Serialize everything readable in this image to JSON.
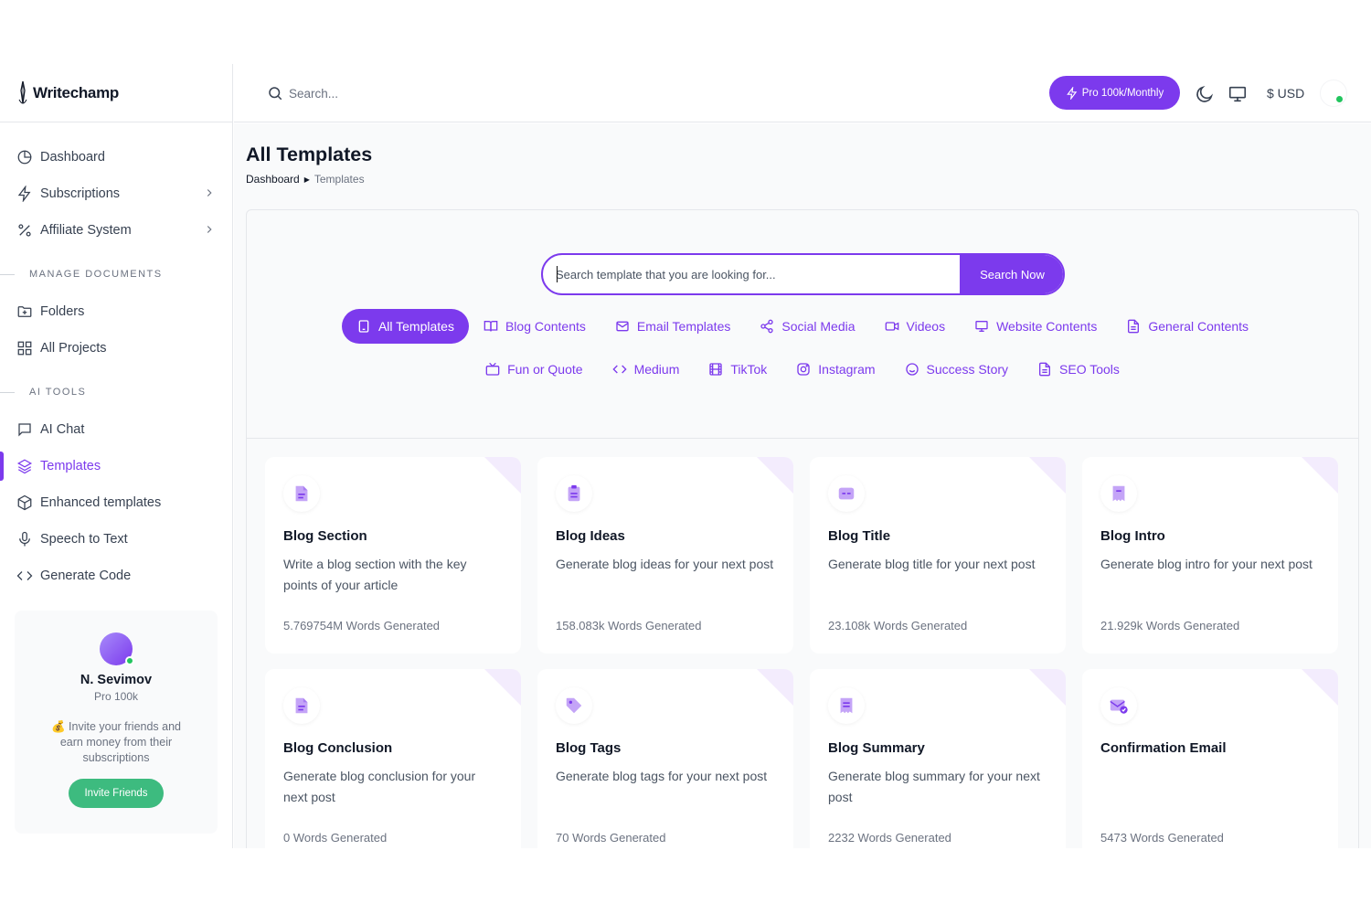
{
  "brand": {
    "name": "Writechamp"
  },
  "topbar": {
    "search_placeholder": "Search...",
    "plan_button": "Pro 100k/Monthly",
    "currency": "$ USD"
  },
  "sidebar": {
    "items": [
      {
        "label": "Dashboard",
        "icon": "pie-chart-icon"
      },
      {
        "label": "Subscriptions",
        "icon": "lightning-icon"
      },
      {
        "label": "Affiliate System",
        "icon": "percent-icon"
      }
    ],
    "section_documents": "MANAGE DOCUMENTS",
    "doc_items": [
      {
        "label": "Folders",
        "icon": "folder-plus-icon"
      },
      {
        "label": "All Projects",
        "icon": "grid-icon"
      }
    ],
    "section_tools": "AI TOOLS",
    "tool_items": [
      {
        "label": "AI Chat",
        "icon": "message-icon"
      },
      {
        "label": "Templates",
        "icon": "layers-icon"
      },
      {
        "label": "Enhanced templates",
        "icon": "cube-icon"
      },
      {
        "label": "Speech to Text",
        "icon": "mic-icon"
      },
      {
        "label": "Generate Code",
        "icon": "code-icon"
      }
    ]
  },
  "user": {
    "name": "N. Sevimov",
    "plan": "Pro 100k",
    "invite_text": "💰 Invite your friends and earn money from their subscriptions",
    "invite_button": "Invite Friends"
  },
  "page": {
    "title": "All Templates",
    "breadcrumb_root": "Dashboard",
    "breadcrumb_current": "Templates"
  },
  "template_search": {
    "placeholder": "Search template that you are looking for...",
    "button": "Search Now"
  },
  "categories_row1": [
    "All Templates",
    "Blog Contents",
    "Email Templates",
    "Social Media",
    "Videos",
    "Website Contents",
    "General Contents"
  ],
  "categories_row2": [
    "Fun or Quote",
    "Medium",
    "TikTok",
    "Instagram",
    "Success Story",
    "SEO Tools"
  ],
  "templates": [
    {
      "title": "Blog Section",
      "desc": "Write a blog section with the key points of your article",
      "words": "5.769754M Words Generated",
      "icon": "file-text-icon"
    },
    {
      "title": "Blog Ideas",
      "desc": "Generate blog ideas for your next post",
      "words": "158.083k Words Generated",
      "icon": "clipboard-icon"
    },
    {
      "title": "Blog Title",
      "desc": "Generate blog title for your next post",
      "words": "23.108k Words Generated",
      "icon": "title-card-icon"
    },
    {
      "title": "Blog Intro",
      "desc": "Generate blog intro for your next post",
      "words": "21.929k Words Generated",
      "icon": "receipt-icon"
    },
    {
      "title": "Blog Conclusion",
      "desc": "Generate blog conclusion for your next post",
      "words": "0 Words Generated",
      "icon": "file-text-icon"
    },
    {
      "title": "Blog Tags",
      "desc": "Generate blog tags for your next post",
      "words": "70 Words Generated",
      "icon": "tag-icon"
    },
    {
      "title": "Blog Summary",
      "desc": "Generate blog summary for your next post",
      "words": "2232 Words Generated",
      "icon": "receipt-icon"
    },
    {
      "title": "Confirmation Email",
      "desc": "",
      "words": "5473 Words Generated",
      "icon": "mail-check-icon"
    }
  ],
  "colors": {
    "accent": "#7c3aed",
    "success": "#3dbb7f",
    "online": "#22c55e"
  }
}
